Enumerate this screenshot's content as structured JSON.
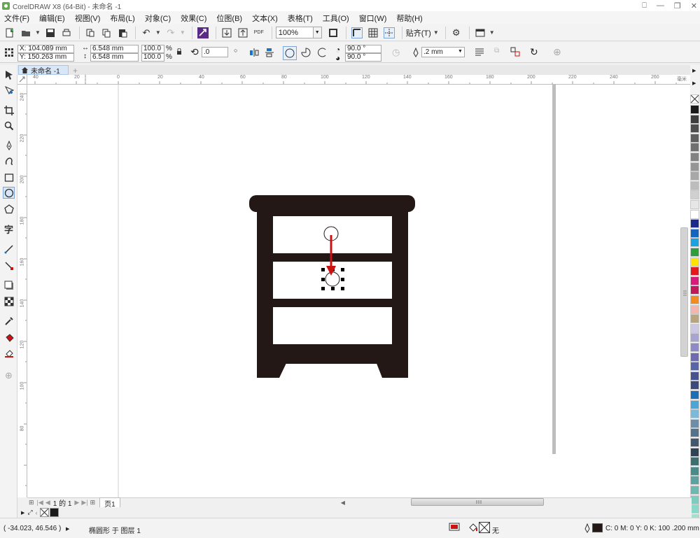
{
  "window": {
    "title": "CorelDRAW X8 (64-Bit) - 未命名 -1"
  },
  "menu": [
    "文件(F)",
    "编辑(E)",
    "视图(V)",
    "布局(L)",
    "对象(C)",
    "效果(C)",
    "位图(B)",
    "文本(X)",
    "表格(T)",
    "工具(O)",
    "窗口(W)",
    "帮助(H)"
  ],
  "toolbar": {
    "zoom": "100%",
    "snap_label": "贴齐(T)",
    "pdf_label": "PDF"
  },
  "props": {
    "x": "X: 104.089 mm",
    "y": "Y: 150.263 mm",
    "w": "6.548 mm",
    "h": "6.548 mm",
    "sx": "100.0",
    "sy": "100.0",
    "pct": "%",
    "rotation": ".0",
    "angle1": "90.0 °",
    "angle2": "90.0 °",
    "outline_width": ".2 mm"
  },
  "document_tab": "未命名 -1",
  "ruler": {
    "h_labels": [
      "40",
      "20",
      "0",
      "20",
      "40",
      "60",
      "80",
      "100",
      "120",
      "140",
      "160",
      "180",
      "200",
      "220",
      "240",
      "260"
    ],
    "v_labels": [
      "240",
      "220",
      "200",
      "180",
      "160",
      "140",
      "120",
      "100",
      "80"
    ],
    "unit": "毫米"
  },
  "page_nav": {
    "current": "1 的 1",
    "page_tab": "页1"
  },
  "status": {
    "coords": "( -34.023, 46.546 )",
    "object_info": "椭圆形 于 图层 1",
    "fill_none": "无",
    "outline": "C: 0 M: 0 Y: 0 K: 100  .200 mm"
  },
  "colors": {
    "furniture": "#231815",
    "arrow": "#cc1111",
    "accent": "#1a73c8"
  },
  "palette": [
    "#1a1a1a",
    "#3d3d3d",
    "#4d4d4d",
    "#5e5e5e",
    "#707070",
    "#828282",
    "#959595",
    "#a8a8a8",
    "#bcbcbc",
    "#d0d0d0",
    "#e6e6e6",
    "#ffffff",
    "#1e2a88",
    "#1565c0",
    "#1aa3de",
    "#2e9e3a",
    "#ffe400",
    "#e31a1c",
    "#d81b7a",
    "#c2185b",
    "#f28c1f",
    "#f4b5b0",
    "#b8a47e",
    "#cdc7e6",
    "#a9a3d4",
    "#8e8ac8",
    "#6e6ab4",
    "#5866a8",
    "#46538f",
    "#3a4a7f",
    "#1a6fb6",
    "#4aa6d6",
    "#7cb8d8",
    "#6c8ea8",
    "#53728c",
    "#41596e",
    "#2f4356",
    "#3d6e70",
    "#4a8a88",
    "#5aa3a0",
    "#6ab9b2",
    "#7cccc0",
    "#8bd8c8",
    "#a0e2d2"
  ]
}
